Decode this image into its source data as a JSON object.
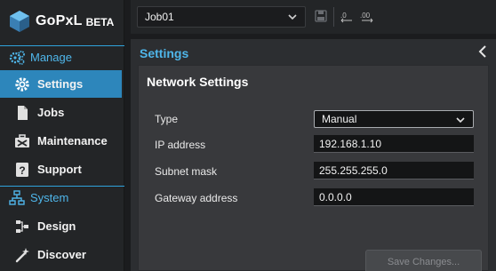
{
  "brand": {
    "name": "GoPxL",
    "badge": "BETA"
  },
  "sidebar": {
    "manage_label": "Manage",
    "system_label": "System",
    "items": [
      {
        "label": "Settings",
        "icon": "gear-icon",
        "active": true
      },
      {
        "label": "Jobs",
        "icon": "document-icon"
      },
      {
        "label": "Maintenance",
        "icon": "toolbox-icon"
      },
      {
        "label": "Support",
        "icon": "question-icon"
      },
      {
        "label": "Design",
        "icon": "flow-icon"
      },
      {
        "label": "Discover",
        "icon": "wand-icon"
      }
    ]
  },
  "toolbar": {
    "job": "Job01"
  },
  "panel": {
    "title": "Settings"
  },
  "network": {
    "title": "Network Settings",
    "type_label": "Type",
    "type_value": "Manual",
    "ip_label": "IP address",
    "ip_value": "192.168.1.10",
    "subnet_label": "Subnet mask",
    "subnet_value": "255.255.255.0",
    "gateway_label": "Gateway address",
    "gateway_value": "0.0.0.0",
    "save_label": "Save Changes..."
  },
  "colors": {
    "accent": "#4fb6ea",
    "active_bg": "#2d86bb",
    "divider": "#2fa3dc"
  }
}
